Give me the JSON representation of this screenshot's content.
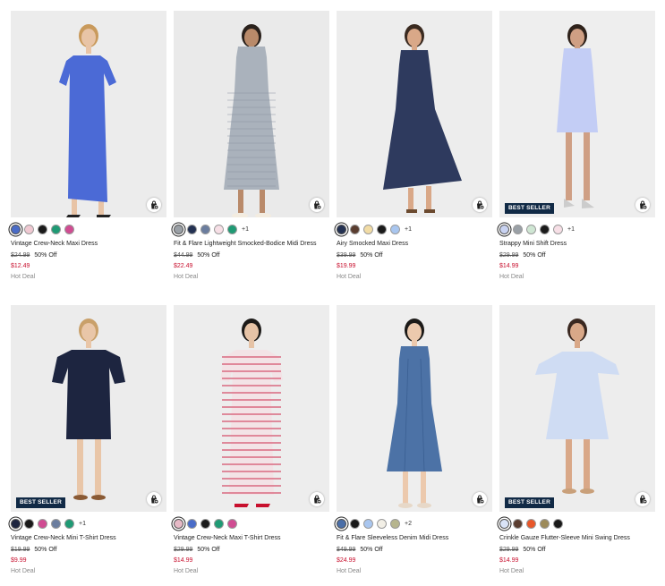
{
  "icons": {
    "bag": "quick-add-bag-icon"
  },
  "products": [
    {
      "name": "Vintage Crew-Neck Maxi Dress",
      "swatches": [
        "#4a6cc8",
        "#f0c9d2",
        "#1a1a1a",
        "#1f9a74",
        "#d04c92"
      ],
      "selected_swatch": 0,
      "more": "",
      "original_price": "$24.99",
      "discount": "50% Off",
      "sale_price": "$12.49",
      "deal": "Hot Deal",
      "badge": "",
      "photo": {
        "bg": "#ececec",
        "dress": "#4b6ad6",
        "skin": "#e8c4a6",
        "hair": "#c99a5c",
        "style": "maxi-tee"
      }
    },
    {
      "name": "Fit & Flare Lightweight Smocked-Bodice Midi Dress",
      "swatches": [
        "#9aa0a6",
        "#233152",
        "#6b7d9e",
        "#f7dfe6",
        "#1f9a74"
      ],
      "selected_swatch": 0,
      "more": "+1",
      "original_price": "$44.99",
      "discount": "50% Off",
      "sale_price": "$22.49",
      "deal": "Hot Deal",
      "badge": "",
      "photo": {
        "bg": "#eaeaea",
        "dress": "#aab2bc",
        "skin": "#b98a6a",
        "hair": "#2a211c",
        "style": "tank-midi"
      }
    },
    {
      "name": "Airy Smocked Maxi Dress",
      "swatches": [
        "#233152",
        "#5a3d30",
        "#f2dca5",
        "#1a1a1a",
        "#a9c6ef"
      ],
      "selected_swatch": 0,
      "more": "+1",
      "original_price": "$39.99",
      "discount": "50% Off",
      "sale_price": "$19.99",
      "deal": "Hot Deal",
      "badge": "",
      "photo": {
        "bg": "#ededed",
        "dress": "#2e3a5e",
        "skin": "#d9a888",
        "hair": "#3a2a20",
        "style": "strap-maxi"
      }
    },
    {
      "name": "Strappy Mini Shift Dress",
      "swatches": [
        "#c9d3f2",
        "#9aa0a6",
        "#cfe6d3",
        "#1a1a1a",
        "#f7dfe6"
      ],
      "selected_swatch": 0,
      "more": "+1",
      "original_price": "$29.99",
      "discount": "50% Off",
      "sale_price": "$14.99",
      "deal": "Hot Deal",
      "badge": "BEST SELLER",
      "photo": {
        "bg": "#eeeeee",
        "dress": "#c3cdf5",
        "skin": "#cf9f84",
        "hair": "#2f221b",
        "style": "strap-mini"
      }
    },
    {
      "name": "Vintage Crew-Neck Mini T-Shirt Dress",
      "swatches": [
        "#1d2540",
        "#1a1a1a",
        "#d04c92",
        "#6b7d9e",
        "#1f9a74"
      ],
      "selected_swatch": 0,
      "more": "+1",
      "original_price": "$19.99",
      "discount": "50% Off",
      "sale_price": "$9.99",
      "deal": "Hot Deal",
      "badge": "BEST SELLER",
      "photo": {
        "bg": "#ececec",
        "dress": "#1d2540",
        "skin": "#e9c6a8",
        "hair": "#c9a06a",
        "style": "mini-tee"
      }
    },
    {
      "name": "Vintage Crew-Neck Maxi T-Shirt Dress",
      "swatches": [
        "#e6b9c6",
        "#4a6cc8",
        "#1a1a1a",
        "#1f9a74",
        "#d04c92"
      ],
      "selected_swatch": 0,
      "more": "",
      "original_price": "$29.99",
      "discount": "50% Off",
      "sale_price": "$14.99",
      "deal": "Hot Deal",
      "badge": "",
      "photo": {
        "bg": "#ededed",
        "dress": "#f3e3e6",
        "skin": "#e6c3a6",
        "hair": "#1c1a18",
        "style": "stripe-maxi"
      }
    },
    {
      "name": "Fit & Flare Sleeveless Denim Midi Dress",
      "swatches": [
        "#4a6ea8",
        "#1a1a1a",
        "#a9c6ef",
        "#f2efe6",
        "#b6b58e"
      ],
      "selected_swatch": 0,
      "more": "+2",
      "original_price": "$49.99",
      "discount": "50% Off",
      "sale_price": "$24.99",
      "deal": "Hot Deal",
      "badge": "",
      "photo": {
        "bg": "#eeeeee",
        "dress": "#4c72a6",
        "skin": "#ecc9ad",
        "hair": "#1c1a18",
        "style": "denim-midi"
      }
    },
    {
      "name": "Crinkle Gauze Flutter-Sleeve Mini Swing Dress",
      "swatches": [
        "#d9e3f7",
        "#5a3d30",
        "#e8572a",
        "#9c8a5a",
        "#1a1a1a"
      ],
      "selected_swatch": 0,
      "more": "",
      "original_price": "$29.99",
      "discount": "50% Off",
      "sale_price": "$14.99",
      "deal": "Hot Deal",
      "badge": "BEST SELLER",
      "photo": {
        "bg": "#ededed",
        "dress": "#cfdcf3",
        "skin": "#d9a888",
        "hair": "#3a2820",
        "style": "flutter-mini"
      }
    }
  ]
}
